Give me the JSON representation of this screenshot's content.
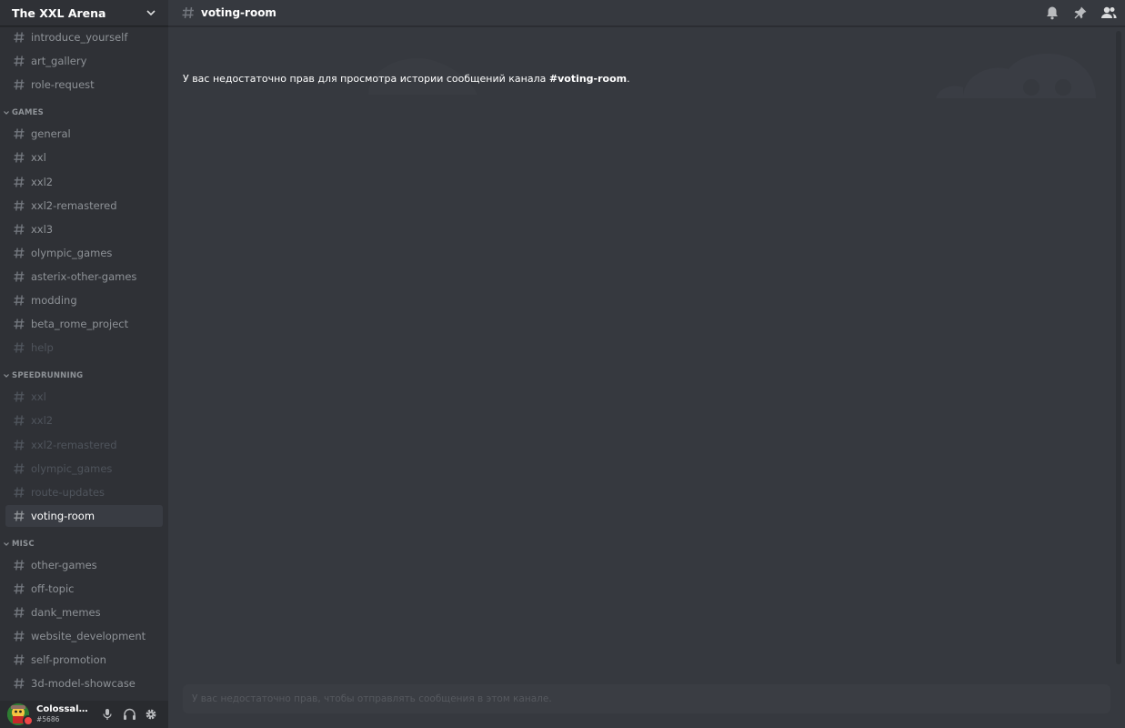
{
  "server": {
    "name": "The XXL Arena"
  },
  "sidebar": {
    "top_channels": [
      {
        "label": "introduce_yourself",
        "state": "normal"
      },
      {
        "label": "art_gallery",
        "state": "normal"
      },
      {
        "label": "role-request",
        "state": "normal"
      }
    ],
    "categories": [
      {
        "label": "GAMES",
        "channels": [
          {
            "label": "general",
            "state": "normal"
          },
          {
            "label": "xxl",
            "state": "normal"
          },
          {
            "label": "xxl2",
            "state": "normal"
          },
          {
            "label": "xxl2-remastered",
            "state": "normal"
          },
          {
            "label": "xxl3",
            "state": "normal"
          },
          {
            "label": "olympic_games",
            "state": "normal"
          },
          {
            "label": "asterix-other-games",
            "state": "normal"
          },
          {
            "label": "modding",
            "state": "normal"
          },
          {
            "label": "beta_rome_project",
            "state": "normal"
          },
          {
            "label": "help",
            "state": "muted"
          }
        ]
      },
      {
        "label": "SPEEDRUNNING",
        "channels": [
          {
            "label": "xxl",
            "state": "muted"
          },
          {
            "label": "xxl2",
            "state": "muted"
          },
          {
            "label": "xxl2-remastered",
            "state": "muted"
          },
          {
            "label": "olympic_games",
            "state": "muted"
          },
          {
            "label": "route-updates",
            "state": "muted"
          },
          {
            "label": "voting-room",
            "state": "selected"
          }
        ]
      },
      {
        "label": "MISC",
        "channels": [
          {
            "label": "other-games",
            "state": "normal"
          },
          {
            "label": "off-topic",
            "state": "normal"
          },
          {
            "label": "dank_memes",
            "state": "normal"
          },
          {
            "label": "website_development",
            "state": "normal"
          },
          {
            "label": "self-promotion",
            "state": "normal"
          },
          {
            "label": "3d-model-showcase",
            "state": "normal"
          }
        ]
      }
    ]
  },
  "user": {
    "name": "ColossalSti...",
    "discriminator": "#5686",
    "status": "dnd",
    "controls": [
      "microphone-icon",
      "headphones-icon",
      "gear-icon"
    ]
  },
  "header": {
    "channel_title": "voting-room",
    "icons": [
      "bell-icon",
      "pin-icon",
      "members-icon"
    ]
  },
  "messages": {
    "no_access_prefix": "У вас недостаточно прав для просмотра истории сообщений канала ",
    "no_access_channel": "#voting-room",
    "no_access_suffix": "."
  },
  "composer": {
    "placeholder": "У вас недостаточно прав, чтобы отправлять сообщения в этом канале."
  },
  "colors": {
    "sidebar_bg": "#2f3136",
    "main_bg": "#36393f",
    "user_panel_bg": "#292b2f",
    "selected_bg": "#393c43",
    "channel_text": "#8e9297",
    "muted_text": "#4f545c",
    "status_dnd": "#f04747"
  }
}
